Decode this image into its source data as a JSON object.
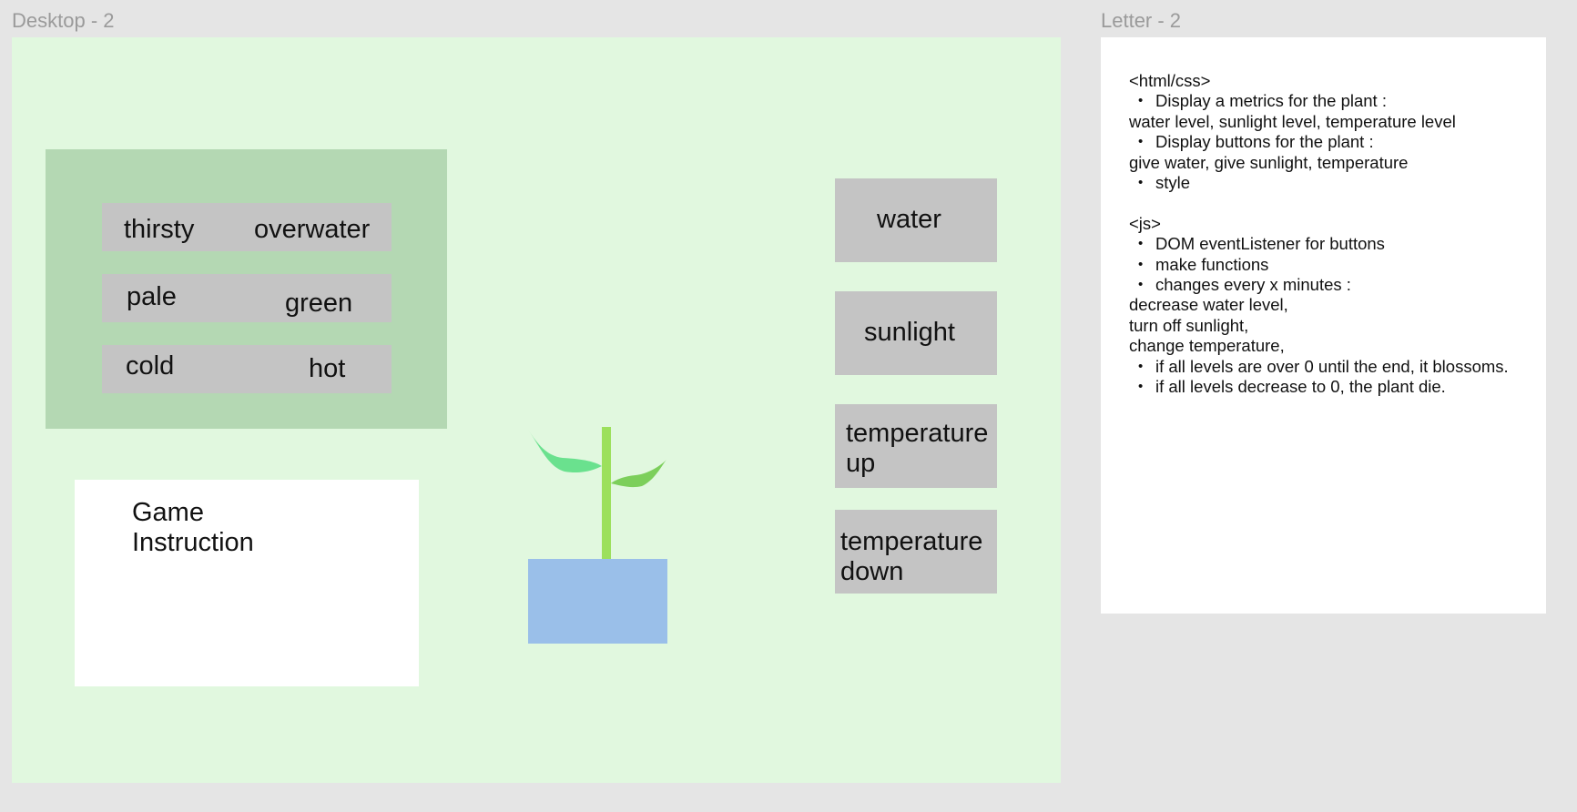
{
  "frames": {
    "desktop_label": "Desktop - 2",
    "letter_label": "Letter - 2"
  },
  "metrics": {
    "water": {
      "low": "thirsty",
      "high": "overwater"
    },
    "sunlight": {
      "low": "pale",
      "high": "green"
    },
    "temperature": {
      "low": "cold",
      "high": "hot"
    }
  },
  "instruction": {
    "title": "Game Instruction"
  },
  "buttons": {
    "water": "water",
    "sunlight": "sunlight",
    "temp_up_line1": "temperature",
    "temp_up_line2": "up",
    "temp_down_line1": "temperature",
    "temp_down_line2": "down"
  },
  "notes": {
    "html_header": "<html/css>",
    "html_b1": "Display a metrics for the plant :",
    "html_l1": "water level, sunlight level, temperature level",
    "html_b2": "Display buttons for the plant :",
    "html_l2": "give water, give sunlight, temperature",
    "html_b3": "style",
    "js_header": "<js>",
    "js_b1": "DOM eventListener for buttons",
    "js_b2": "make functions",
    "js_b3": "changes every x minutes :",
    "js_l1": "decrease water level,",
    "js_l2": "turn off sunlight,",
    "js_l3": "change temperature,",
    "js_b4": "if all levels are over 0 until the end, it blossoms.",
    "js_b5": "if all levels decrease to 0,  the plant die."
  },
  "colors": {
    "canvas_bg": "#e5e5e5",
    "desktop_bg": "#e1f8df",
    "panel_bg": "#b4d8b3",
    "gray_box": "#c4c4c4",
    "pot": "#9abfe9",
    "stem": "#9ce05c",
    "leaf_left": "#6ae18e",
    "leaf_right": "#7ccf5b"
  },
  "icons": [
    "plant-illustration"
  ]
}
